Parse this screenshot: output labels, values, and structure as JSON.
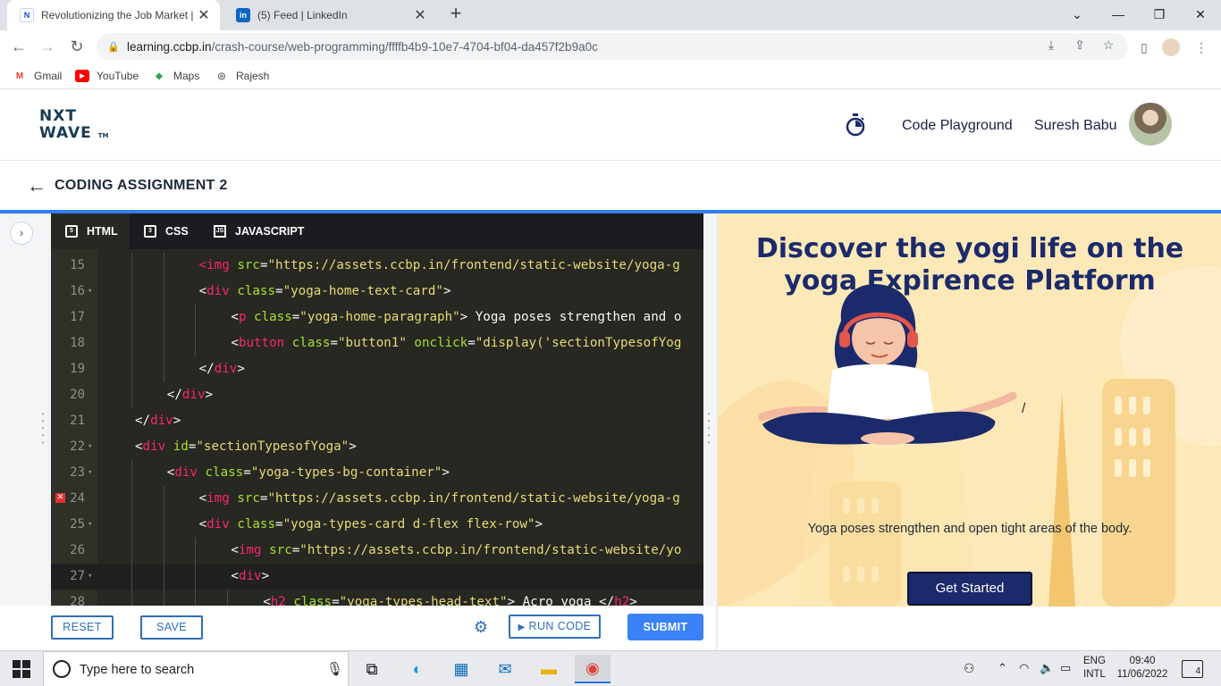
{
  "browser": {
    "tabs": [
      {
        "title": "Revolutionizing the Job Market |",
        "icon": "ccbp-favicon",
        "active": true
      },
      {
        "title": "(5) Feed | LinkedIn",
        "icon": "linkedin-favicon",
        "active": false
      }
    ],
    "new_tab": "+",
    "url_host": "learning.ccbp.in",
    "url_path": "/crash-course/web-programming/ffffb4b9-10e7-4704-bf04-da457f2b9a0c",
    "bookmarks": [
      {
        "label": "Gmail",
        "icon": "gmail-icon"
      },
      {
        "label": "YouTube",
        "icon": "youtube-icon"
      },
      {
        "label": "Maps",
        "icon": "maps-icon"
      },
      {
        "label": "Rajesh",
        "icon": "globe-icon"
      }
    ]
  },
  "app": {
    "logo_line1": "NXT",
    "logo_line2": "WAVE",
    "logo_tm": "TM",
    "code_playground": "Code Playground",
    "user_name": "Suresh Babu",
    "assignment_title": "CODING ASSIGNMENT 2"
  },
  "editor": {
    "tabs": [
      {
        "label": "HTML",
        "icon": "html5-icon",
        "active": true
      },
      {
        "label": "CSS",
        "icon": "css3-icon",
        "active": false
      },
      {
        "label": "JAVASCRIPT",
        "icon": "js-icon",
        "active": false
      }
    ],
    "lines": [
      {
        "num": "15",
        "fold": false,
        "error": false,
        "indent": 3,
        "tokens": [
          [
            "t-tag",
            "<img"
          ],
          [
            "t-txt",
            " "
          ],
          [
            "t-attr",
            "src"
          ],
          [
            "t-txt",
            "="
          ],
          [
            "t-str",
            "\"https://assets.ccbp.in/frontend/static-website/yoga-g"
          ]
        ]
      },
      {
        "num": "16",
        "fold": true,
        "error": false,
        "indent": 3,
        "tokens": [
          [
            "t-txt",
            "<"
          ],
          [
            "t-tag",
            "div"
          ],
          [
            "t-txt",
            " "
          ],
          [
            "t-attr",
            "class"
          ],
          [
            "t-txt",
            "="
          ],
          [
            "t-str",
            "\"yoga-home-text-card\""
          ],
          [
            "t-txt",
            ">"
          ]
        ]
      },
      {
        "num": "17",
        "fold": false,
        "error": false,
        "indent": 4,
        "tokens": [
          [
            "t-txt",
            "<"
          ],
          [
            "t-tag",
            "p"
          ],
          [
            "t-txt",
            " "
          ],
          [
            "t-attr",
            "class"
          ],
          [
            "t-txt",
            "="
          ],
          [
            "t-str",
            "\"yoga-home-paragraph\""
          ],
          [
            "t-txt",
            "> Yoga poses strengthen and o"
          ]
        ]
      },
      {
        "num": "18",
        "fold": false,
        "error": false,
        "indent": 4,
        "tokens": [
          [
            "t-txt",
            "<"
          ],
          [
            "t-tag",
            "button"
          ],
          [
            "t-txt",
            " "
          ],
          [
            "t-attr",
            "class"
          ],
          [
            "t-txt",
            "="
          ],
          [
            "t-str",
            "\"button1\""
          ],
          [
            "t-txt",
            " "
          ],
          [
            "t-attr",
            "onclick"
          ],
          [
            "t-txt",
            "="
          ],
          [
            "t-str",
            "\"display('sectionTypesofYog"
          ]
        ]
      },
      {
        "num": "19",
        "fold": false,
        "error": false,
        "indent": 3,
        "tokens": [
          [
            "t-txt",
            "</"
          ],
          [
            "t-tag",
            "div"
          ],
          [
            "t-txt",
            ">"
          ]
        ]
      },
      {
        "num": "20",
        "fold": false,
        "error": false,
        "indent": 2,
        "tokens": [
          [
            "t-txt",
            "</"
          ],
          [
            "t-tag",
            "div"
          ],
          [
            "t-txt",
            ">"
          ]
        ]
      },
      {
        "num": "21",
        "fold": false,
        "error": false,
        "indent": 1,
        "tokens": [
          [
            "t-txt",
            "</"
          ],
          [
            "t-tag",
            "div"
          ],
          [
            "t-txt",
            ">"
          ]
        ]
      },
      {
        "num": "22",
        "fold": true,
        "error": false,
        "indent": 1,
        "tokens": [
          [
            "t-txt",
            "<"
          ],
          [
            "t-tag",
            "div"
          ],
          [
            "t-txt",
            " "
          ],
          [
            "t-attr",
            "id"
          ],
          [
            "t-txt",
            "="
          ],
          [
            "t-str",
            "\"sectionTypesofYoga\""
          ],
          [
            "t-txt",
            ">"
          ]
        ]
      },
      {
        "num": "23",
        "fold": true,
        "error": false,
        "indent": 2,
        "tokens": [
          [
            "t-txt",
            "<"
          ],
          [
            "t-tag",
            "div"
          ],
          [
            "t-txt",
            " "
          ],
          [
            "t-attr",
            "class"
          ],
          [
            "t-txt",
            "="
          ],
          [
            "t-str",
            "\"yoga-types-bg-container\""
          ],
          [
            "t-txt",
            ">"
          ]
        ]
      },
      {
        "num": "24",
        "fold": false,
        "error": true,
        "indent": 3,
        "tokens": [
          [
            "t-txt",
            "<"
          ],
          [
            "t-tag",
            "img"
          ],
          [
            "t-txt",
            " "
          ],
          [
            "t-attr",
            "src"
          ],
          [
            "t-txt",
            "="
          ],
          [
            "t-str",
            "\"https://assets.ccbp.in/frontend/static-website/yoga-g"
          ]
        ]
      },
      {
        "num": "25",
        "fold": true,
        "error": false,
        "indent": 3,
        "tokens": [
          [
            "t-txt",
            "<"
          ],
          [
            "t-tag",
            "div"
          ],
          [
            "t-txt",
            " "
          ],
          [
            "t-attr",
            "class"
          ],
          [
            "t-txt",
            "="
          ],
          [
            "t-str",
            "\"yoga-types-card d-flex flex-row\""
          ],
          [
            "t-txt",
            ">"
          ]
        ]
      },
      {
        "num": "26",
        "fold": false,
        "error": false,
        "indent": 4,
        "tokens": [
          [
            "t-txt",
            "<"
          ],
          [
            "t-tag",
            "img"
          ],
          [
            "t-txt",
            " "
          ],
          [
            "t-attr",
            "src"
          ],
          [
            "t-txt",
            "="
          ],
          [
            "t-str",
            "\"https://assets.ccbp.in/frontend/static-website/yo"
          ]
        ]
      },
      {
        "num": "27",
        "fold": true,
        "error": false,
        "indent": 4,
        "active": true,
        "tokens": [
          [
            "t-txt",
            "<"
          ],
          [
            "t-tag",
            "div"
          ],
          [
            "t-txt",
            ">"
          ]
        ]
      },
      {
        "num": "28",
        "fold": false,
        "error": false,
        "indent": 5,
        "tokens": [
          [
            "t-txt",
            "<"
          ],
          [
            "t-tag",
            "h2"
          ],
          [
            "t-txt",
            " "
          ],
          [
            "t-attr",
            "class"
          ],
          [
            "t-txt",
            "="
          ],
          [
            "t-str",
            "\"yoga-types-head-text\""
          ],
          [
            "t-txt",
            "> Acro yoga </"
          ],
          [
            "t-tag",
            "h2"
          ],
          [
            "t-txt",
            ">"
          ]
        ]
      }
    ],
    "reset_label": "RESET",
    "save_label": "SAVE",
    "run_label": "RUN CODE",
    "submit_label": "SUBMIT"
  },
  "preview": {
    "heading": "Discover the yogi life on the yoga Expirence Platform",
    "slash": "/",
    "paragraph": "Yoga poses strengthen and open tight areas of the body.",
    "button": "Get Started",
    "bg_color": "#fde8b8",
    "heading_color": "#1b2a6b"
  },
  "taskbar": {
    "search_placeholder": "Type here to search",
    "lang1": "ENG",
    "lang2": "INTL",
    "time": "09:40",
    "date": "11/06/2022",
    "notifications": "4"
  }
}
